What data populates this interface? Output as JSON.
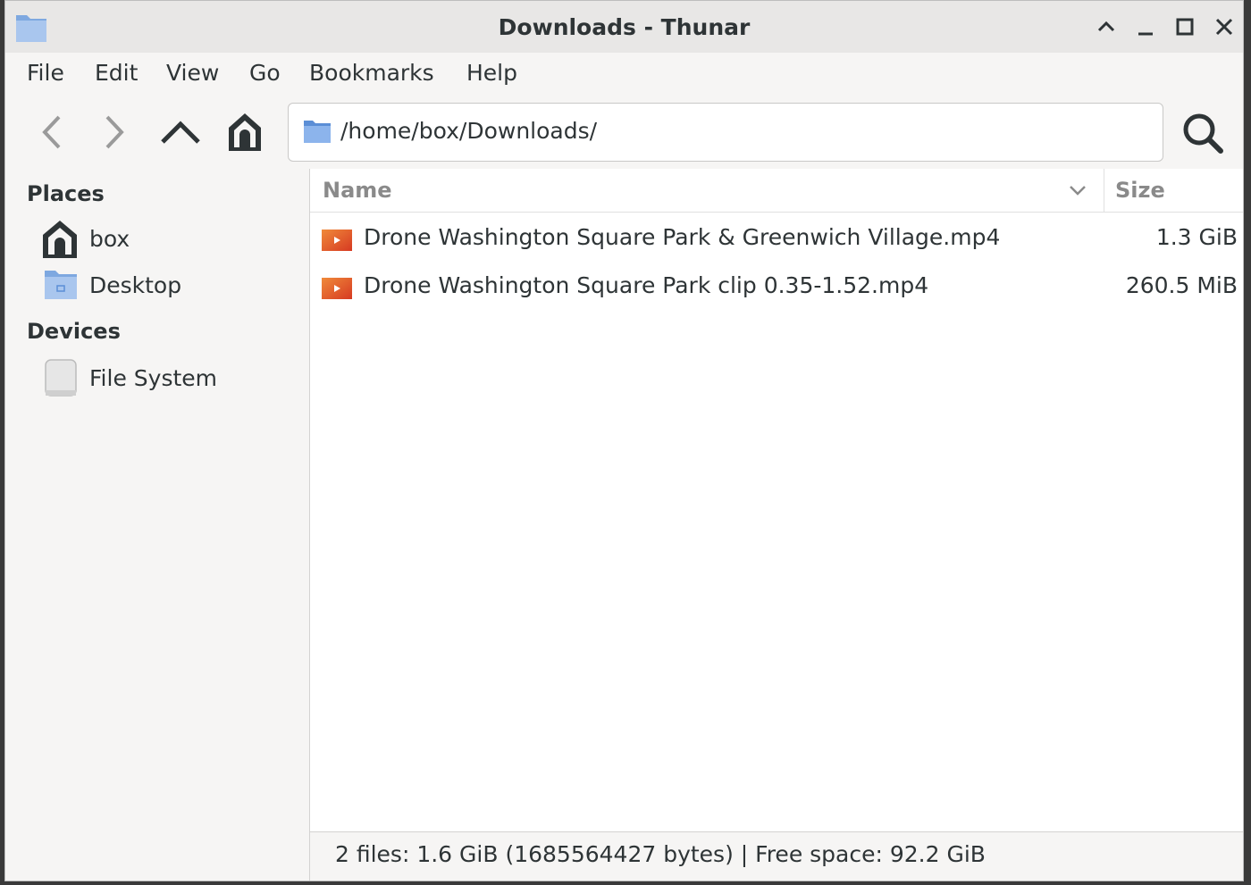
{
  "window": {
    "title": "Downloads - Thunar"
  },
  "menu": {
    "items": [
      "File",
      "Edit",
      "View",
      "Go",
      "Bookmarks",
      "Help"
    ]
  },
  "toolbar": {
    "location_path": "/home/box/Downloads/"
  },
  "sidebar": {
    "places_heading": "Places",
    "places": [
      {
        "label": "box",
        "icon": "home-icon"
      },
      {
        "label": "Desktop",
        "icon": "desktop-folder-icon"
      }
    ],
    "devices_heading": "Devices",
    "devices": [
      {
        "label": "File System",
        "icon": "drive-icon"
      }
    ]
  },
  "files": {
    "columns": {
      "name": "Name",
      "size": "Size"
    },
    "rows": [
      {
        "name": "Drone Washington Square Park & Greenwich Village.mp4",
        "size": "1.3 GiB",
        "icon": "video-file-icon"
      },
      {
        "name": "Drone Washington Square Park clip 0.35-1.52.mp4",
        "size": "260.5 MiB",
        "icon": "video-file-icon"
      }
    ]
  },
  "status": {
    "text": "2 files: 1.6 GiB (1685564427 bytes)  |  Free space: 92.2 GiB"
  },
  "colors": {
    "folder_blue": "#7ea8e0",
    "video_orange": "#e2542a"
  }
}
